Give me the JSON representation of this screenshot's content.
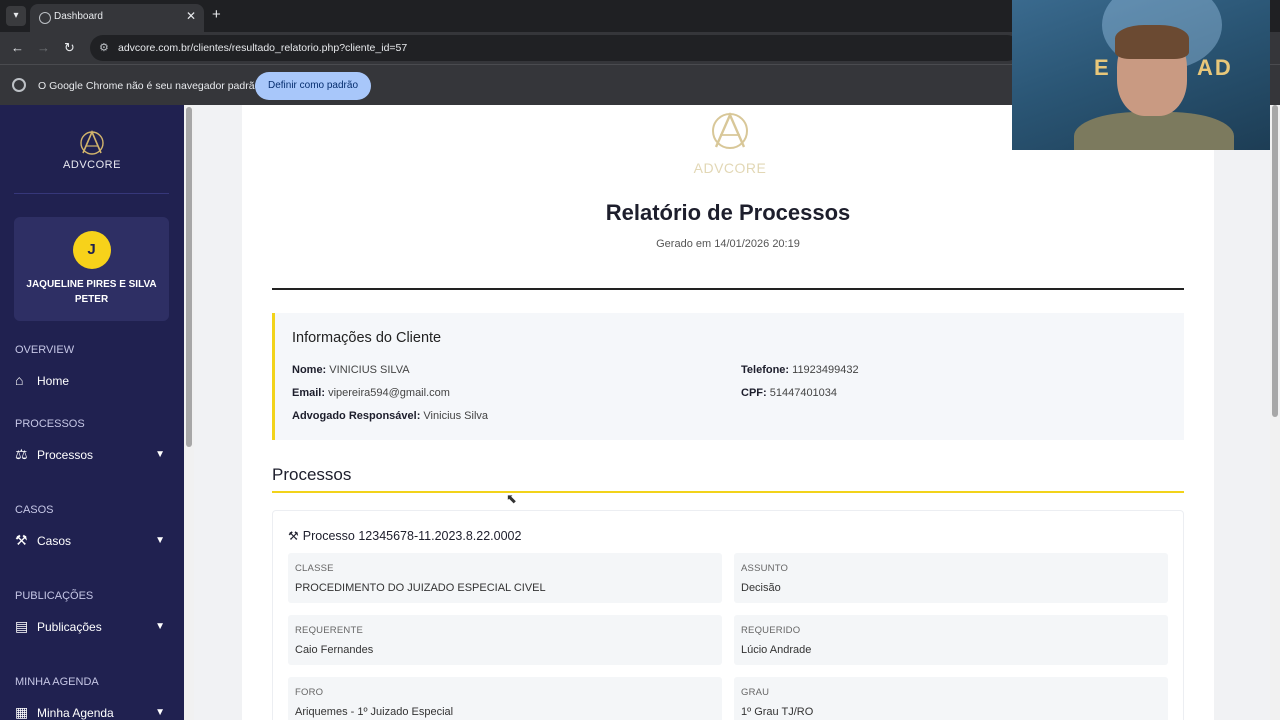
{
  "browser": {
    "tab_title": "Dashboard",
    "url": "advcore.com.br/clientes/resultado_relatorio.php?cliente_id=57",
    "infobar_text": "O Google Chrome não é seu navegador padrão",
    "infobar_button": "Definir como padrão"
  },
  "sidebar": {
    "brand": "ADVCORE",
    "user_initial": "J",
    "user_name": "JAQUELINE PIRES E SILVA PETER",
    "sections": [
      {
        "label": "OVERVIEW",
        "item": "Home",
        "icon": "home-icon"
      },
      {
        "label": "PROCESSOS",
        "item": "Processos",
        "icon": "scales-icon"
      },
      {
        "label": "CASOS",
        "item": "Casos",
        "icon": "gavel-icon"
      },
      {
        "label": "PUBLICAÇÕES",
        "item": "Publicações",
        "icon": "newspaper-icon"
      },
      {
        "label": "MINHA AGENDA",
        "item": "Minha Agenda",
        "icon": "calendar-icon"
      }
    ]
  },
  "report": {
    "logo_text": "ADVCORE",
    "title": "Relatório de Processos",
    "generated": "Gerado em 14/01/2026 20:19",
    "client": {
      "heading": "Informações do Cliente",
      "nome_label": "Nome:",
      "nome": "VINICIUS SILVA",
      "email_label": "Email:",
      "email": "vipereira594@gmail.com",
      "advogado_label": "Advogado Responsável:",
      "advogado": "Vinicius Silva",
      "telefone_label": "Telefone:",
      "telefone": "11923499432",
      "cpf_label": "CPF:",
      "cpf": "51447401034"
    },
    "processos_heading": "Processos",
    "processo": {
      "title": "Processo 12345678-11.2023.8.22.0002",
      "fields": [
        {
          "label": "CLASSE",
          "value": "PROCEDIMENTO DO JUIZADO ESPECIAL CIVEL"
        },
        {
          "label": "ASSUNTO",
          "value": "Decisão"
        },
        {
          "label": "REQUERENTE",
          "value": "Caio Fernandes"
        },
        {
          "label": "REQUERIDO",
          "value": "Lúcio Andrade"
        },
        {
          "label": "FORO",
          "value": "Ariquemes - 1º Juizado Especial"
        },
        {
          "label": "GRAU",
          "value": "1º Grau TJ/RO"
        }
      ]
    }
  },
  "webcam": {
    "sign_left": "E",
    "sign_right": "AD"
  }
}
